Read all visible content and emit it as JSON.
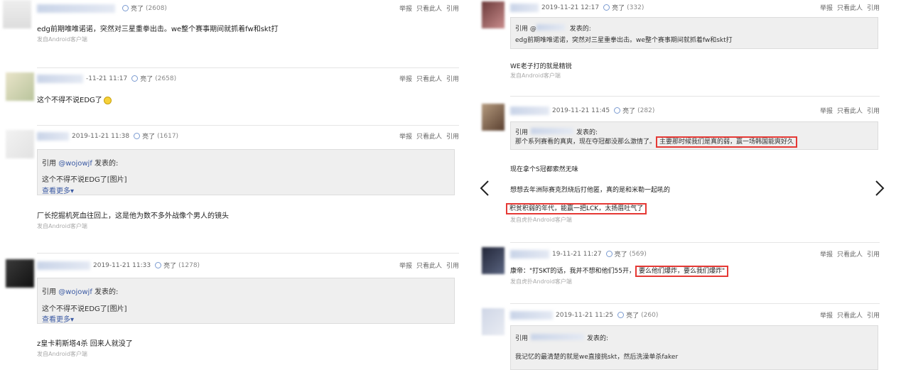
{
  "actions": {
    "report": "举报",
    "only_this": "只看此人",
    "quote": "引用"
  },
  "light_label": "亮了",
  "left": {
    "posts": [
      {
        "meta": "(2608)",
        "date": "",
        "content": "edg前期唯唯诺诺，突然对三星重拳出击。we整个赛事期间就抓着fw和skt打",
        "device": "发自Android客户端"
      },
      {
        "date": "-11-21 11:17",
        "count": "(2658)",
        "content": "这个不得不说EDG了"
      },
      {
        "date": "2019-11-21 11:38",
        "count": "(1617)",
        "quote_prefix": "引用 ",
        "quote_user": "@wojowjf",
        "quote_suffix": " 发表的:",
        "quote_body": "这个不得不说EDG了[图片]",
        "more": "查看更多▾",
        "content": "厂长挖掘机死血往回上，这是他为数不多外战像个男人的镜头",
        "device": "发自Android客户端"
      },
      {
        "date": "2019-11-21 11:33",
        "count": "(1278)",
        "quote_prefix": "引用 ",
        "quote_user": "@wojowjf",
        "quote_suffix": " 发表的:",
        "quote_body": "这个不得不说EDG了[图片]",
        "more": "查看更多▾",
        "content": "z皇卡莉斯塔4杀 回来人就没了",
        "device": "发自Android客户端"
      }
    ]
  },
  "right": {
    "posts": [
      {
        "date": "2019-11-21 12:17",
        "count": "(332)",
        "quote_prefix": "引用 @",
        "quote_suffix": " 发表的:",
        "quote_body": "edg前期唯唯诺诺，突然对三星重拳出击。we整个赛事期间就抓着fw和skt打",
        "content": "WE老子打的就是精锐",
        "device": "发自Android客户端"
      },
      {
        "date": "2019-11-21 11:45",
        "count": "(282)",
        "quote_prefix": "引用",
        "quote_suffix": "发表的:",
        "quote_body_a": "那个系列赛看的真爽，现在夺冠都没那么激情了。",
        "quote_body_hl": "主要那时候我们是真的弱，赢一场韩国能爽好久",
        "line1": "现在拿个S冠都索然无味",
        "line2": "想想去年洲际赛克烈绕后打他匿，真的是和米勒一起吼的",
        "line3": "积贫积弱的年代，能赢一把LCK，太扬眉吐气了",
        "device": "发自虎扑Android客户端"
      },
      {
        "date": "19-11-21 11:27",
        "count": "(569)",
        "content_a": "康帝：\"打SKT的话，我并不想和他们55开，",
        "content_hl": "要么他们爆炸，要么我们爆炸\"",
        "device": "发自虎扑Android客户端"
      },
      {
        "date": "2019-11-21 11:25",
        "count": "(260)",
        "quote_prefix": "引用",
        "quote_suffix": "发表的:",
        "quote_body": "我记忆的最清楚的就是we直接挑skt，然后洗澡单杀faker"
      }
    ]
  },
  "nav": {
    "prev_icon": "chevron-left-icon",
    "next_icon": "chevron-right-icon"
  }
}
